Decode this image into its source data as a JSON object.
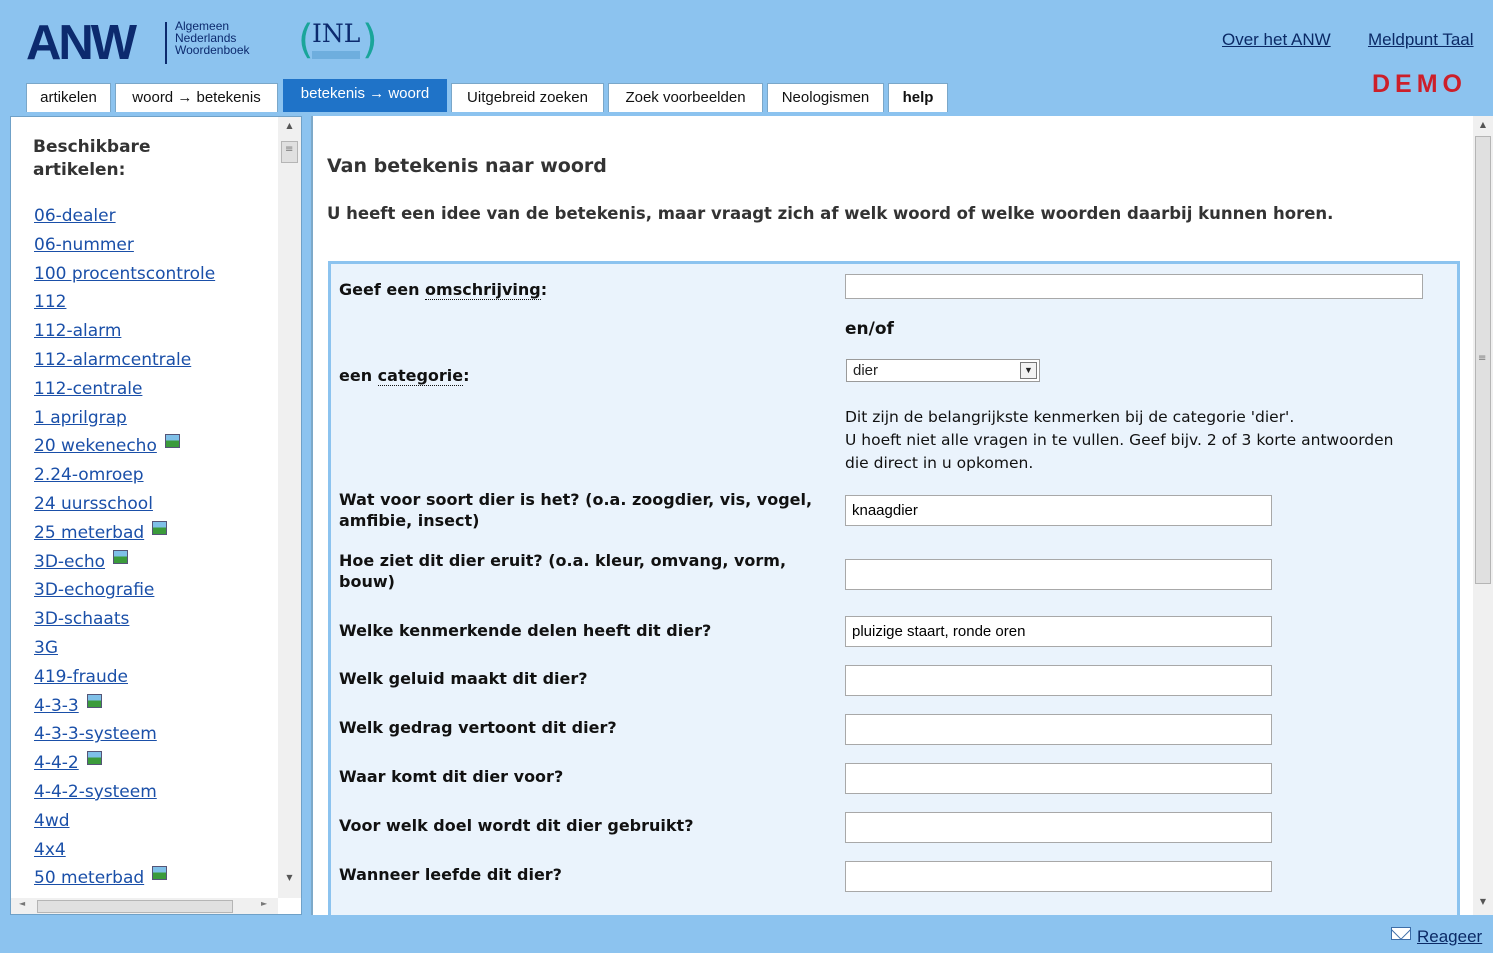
{
  "logo": {
    "anw_text": "ANW",
    "subtitle_lines": [
      "Algemeen",
      "Nederlands",
      "Woordenboek"
    ],
    "inl_text": "INL"
  },
  "header_links": [
    "Over het ANW",
    "Meldpunt Taal"
  ],
  "demo_label": "DEMO",
  "tabs": [
    {
      "label": "artikelen",
      "active": false
    },
    {
      "label": "woord → betekenis",
      "active": false
    },
    {
      "label": "betekenis → woord",
      "active": true
    },
    {
      "label": "Uitgebreid zoeken",
      "active": false
    },
    {
      "label": "Zoek voorbeelden",
      "active": false
    },
    {
      "label": "Neologismen",
      "active": false
    },
    {
      "label": "help",
      "active": false
    }
  ],
  "sidebar": {
    "title": "Beschikbare artikelen:",
    "articles": [
      {
        "label": "06-dealer",
        "has_image": false
      },
      {
        "label": "06-nummer",
        "has_image": false
      },
      {
        "label": "100 procentscontrole",
        "has_image": false
      },
      {
        "label": "112",
        "has_image": false
      },
      {
        "label": "112-alarm",
        "has_image": false
      },
      {
        "label": "112-alarmcentrale",
        "has_image": false
      },
      {
        "label": "112-centrale",
        "has_image": false
      },
      {
        "label": "1 aprilgrap",
        "has_image": false
      },
      {
        "label": "20 wekenecho",
        "has_image": true
      },
      {
        "label": "2.24-omroep",
        "has_image": false
      },
      {
        "label": "24 uursschool",
        "has_image": false
      },
      {
        "label": "25 meterbad",
        "has_image": true
      },
      {
        "label": "3D-echo",
        "has_image": true
      },
      {
        "label": "3D-echografie",
        "has_image": false
      },
      {
        "label": "3D-schaats",
        "has_image": false
      },
      {
        "label": "3G",
        "has_image": false
      },
      {
        "label": "419-fraude",
        "has_image": false
      },
      {
        "label": "4-3-3",
        "has_image": true
      },
      {
        "label": "4-3-3-systeem",
        "has_image": false
      },
      {
        "label": "4-4-2",
        "has_image": true
      },
      {
        "label": "4-4-2-systeem",
        "has_image": false
      },
      {
        "label": "4wd",
        "has_image": false
      },
      {
        "label": "4x4",
        "has_image": false
      },
      {
        "label": "50 meterbad",
        "has_image": true
      }
    ]
  },
  "main": {
    "title": "Van betekenis naar woord",
    "intro": "U heeft een idee van de betekenis, maar vraagt zich af welk woord of welke woorden daarbij kunnen horen.",
    "form": {
      "omschrijving_label_prefix": "Geef een ",
      "omschrijving_label_term": "omschrijving",
      "omschrijving_value": "",
      "enof": "en/of",
      "categorie_label_prefix": "een ",
      "categorie_label_term": "categorie",
      "categorie_value": "dier",
      "info_lines": [
        "Dit zijn de belangrijkste kenmerken bij de categorie 'dier'.",
        "U hoeft niet alle vragen in te vullen. Geef bijv. 2 of 3 korte antwoorden",
        "die direct in u opkomen."
      ],
      "questions": [
        {
          "label": "Wat voor soort dier is het? (o.a. zoogdier, vis, vogel, amfibie, insect)",
          "value": "knaagdier"
        },
        {
          "label": "Hoe ziet dit dier eruit? (o.a. kleur, omvang, vorm, bouw)",
          "value": ""
        },
        {
          "label": "Welke kenmerkende delen heeft dit dier?",
          "value": "pluizige staart, ronde oren"
        },
        {
          "label": "Welk geluid maakt dit dier?",
          "value": ""
        },
        {
          "label": "Welk gedrag vertoont dit dier?",
          "value": ""
        },
        {
          "label": "Waar komt dit dier voor?",
          "value": ""
        },
        {
          "label": "Voor welk doel wordt dit dier gebruikt?",
          "value": ""
        },
        {
          "label": "Wanneer leefde dit dier?",
          "value": ""
        }
      ]
    }
  },
  "footer": {
    "reageer": "Reageer"
  },
  "colors": {
    "header_bg": "#8cc3ef",
    "active_tab": "#1f73c8",
    "demo_red": "#cc1f2a",
    "form_bg": "#eaf3fc",
    "link": "#1a4fa8"
  }
}
